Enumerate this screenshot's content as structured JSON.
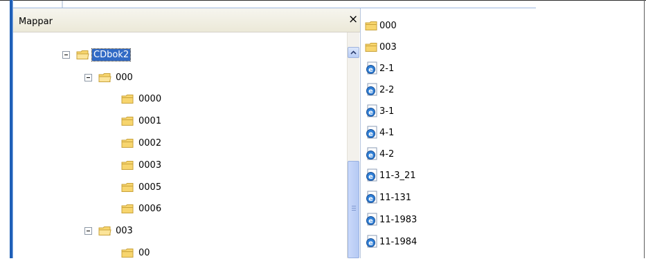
{
  "folders_pane": {
    "title": "Mappar",
    "close_label": "×",
    "tree": [
      {
        "label": "CDbok2",
        "level": 0,
        "expanded": true,
        "selected": true
      },
      {
        "label": "000",
        "level": 1,
        "expanded": true,
        "selected": false
      },
      {
        "label": "0000",
        "level": 2,
        "selected": false
      },
      {
        "label": "0001",
        "level": 2,
        "selected": false
      },
      {
        "label": "0002",
        "level": 2,
        "selected": false
      },
      {
        "label": "0003",
        "level": 2,
        "selected": false
      },
      {
        "label": "0005",
        "level": 2,
        "selected": false
      },
      {
        "label": "0006",
        "level": 2,
        "selected": false
      },
      {
        "label": "003",
        "level": 1,
        "expanded": true,
        "selected": false
      },
      {
        "label": "00",
        "level": 2,
        "selected": false
      }
    ]
  },
  "file_list": {
    "items": [
      {
        "label": "000",
        "type": "folder"
      },
      {
        "label": "003",
        "type": "folder"
      },
      {
        "label": "2-1",
        "type": "html-document"
      },
      {
        "label": "2-2",
        "type": "html-document"
      },
      {
        "label": "3-1",
        "type": "html-document"
      },
      {
        "label": "4-1",
        "type": "html-document"
      },
      {
        "label": "4-2",
        "type": "html-document"
      },
      {
        "label": "11-3_21",
        "type": "html-document"
      },
      {
        "label": "11-131",
        "type": "html-document"
      },
      {
        "label": "11-1983",
        "type": "html-document"
      },
      {
        "label": "11-1984",
        "type": "html-document"
      }
    ]
  },
  "colors": {
    "selection": "#316ac5",
    "folder_fill": "#f7d56e",
    "folder_stroke": "#c9a23a",
    "window_frame": "#1f5fb7"
  }
}
